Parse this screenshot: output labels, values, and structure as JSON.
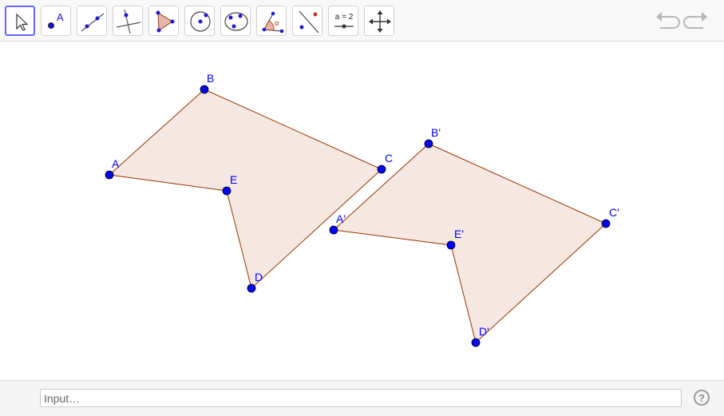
{
  "toolbar": {
    "tools": [
      {
        "name": "move-tool",
        "active": true
      },
      {
        "name": "point-tool",
        "label": "A"
      },
      {
        "name": "line-tool"
      },
      {
        "name": "perpendicular-line-tool"
      },
      {
        "name": "polygon-tool"
      },
      {
        "name": "circle-center-point-tool"
      },
      {
        "name": "conic-tool"
      },
      {
        "name": "angle-tool",
        "label": "α"
      },
      {
        "name": "reflect-tool"
      },
      {
        "name": "slider-tool",
        "label": "a = 2"
      },
      {
        "name": "move-graphics-view-tool"
      }
    ],
    "undo_icon": "undo-icon",
    "redo_icon": "redo-icon"
  },
  "graphics": {
    "colors": {
      "point": "#0000ff",
      "edge": "#993300",
      "fill": "#f5e8e3"
    },
    "polygons": [
      {
        "name": "polygon-ABCDE",
        "points": [
          {
            "id": "A",
            "label": "A"
          },
          {
            "id": "B",
            "label": "B"
          },
          {
            "id": "C",
            "label": "C"
          },
          {
            "id": "D",
            "label": "D"
          },
          {
            "id": "E",
            "label": "E"
          }
        ]
      },
      {
        "name": "polygon-A'B'C'D'E'",
        "points": [
          {
            "id": "A1",
            "label": "A'"
          },
          {
            "id": "B1",
            "label": "B'"
          },
          {
            "id": "C1",
            "label": "C'"
          },
          {
            "id": "D1",
            "label": "D'"
          },
          {
            "id": "E1",
            "label": "E'"
          }
        ]
      }
    ]
  },
  "input_bar": {
    "placeholder": "Input…",
    "help_label": "?"
  }
}
